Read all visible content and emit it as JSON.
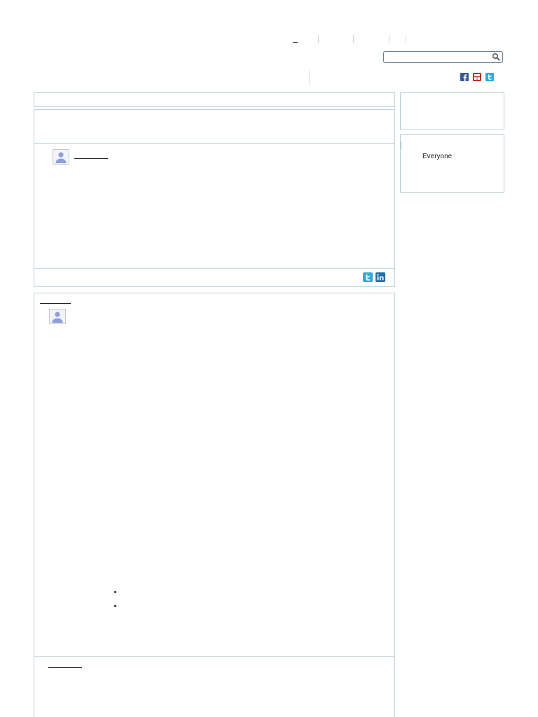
{
  "search": {
    "placeholder": "",
    "value": ""
  },
  "sidebar": {
    "audience_label": "Everyone"
  },
  "icons": {
    "search": "search-icon",
    "facebook": "facebook-icon",
    "youtube": "youtube-icon",
    "twitter": "twitter-icon",
    "linkedin": "linkedin-icon",
    "avatar": "avatar-icon"
  },
  "colors": {
    "panel_border": "#b9ced6",
    "facebook": "#3b5998",
    "youtube": "#c4302b",
    "twitter": "#33aadd",
    "linkedin": "#1f6fa8"
  }
}
